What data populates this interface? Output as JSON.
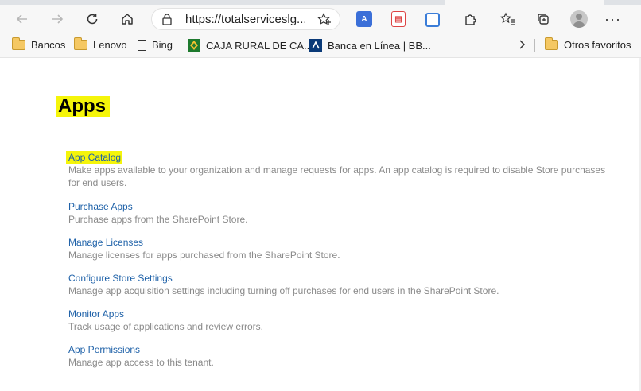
{
  "browser": {
    "url": "https://totalserviceslg...",
    "favorites": [
      {
        "label": "Bancos",
        "icon": "folder-icon"
      },
      {
        "label": "Lenovo",
        "icon": "folder-icon"
      },
      {
        "label": "Bing",
        "icon": "page-icon"
      },
      {
        "label": "CAJA RURAL DE CA...",
        "icon": "caja-rural-icon"
      },
      {
        "label": "Banca en Línea | BB...",
        "icon": "bbva-icon"
      }
    ],
    "other_favorites": "Otros favoritos"
  },
  "page": {
    "title": "Apps",
    "items": [
      {
        "link": "App Catalog",
        "desc": "Make apps available to your organization and manage requests for apps. An app catalog is required to disable Store purchases for end users."
      },
      {
        "link": "Purchase Apps",
        "desc": "Purchase apps from the SharePoint Store."
      },
      {
        "link": "Manage Licenses",
        "desc": "Manage licenses for apps purchased from the SharePoint Store."
      },
      {
        "link": "Configure Store Settings",
        "desc": "Manage app acquisition settings including turning off purchases for end users in the SharePoint Store."
      },
      {
        "link": "Monitor Apps",
        "desc": "Track usage of applications and review errors."
      },
      {
        "link": "App Permissions",
        "desc": "Manage app access to this tenant."
      }
    ]
  },
  "colors": {
    "highlight": "#f5f50a",
    "link": "#1e61a8",
    "desc": "#8a8a8a"
  }
}
